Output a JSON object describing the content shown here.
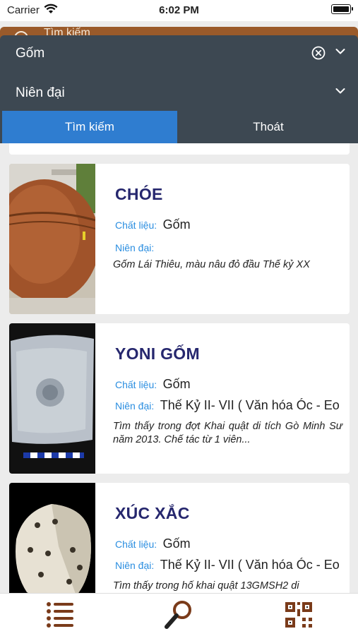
{
  "status_bar": {
    "carrier": "Carrier",
    "time": "6:02 PM"
  },
  "app_header": {
    "search_label": "Tìm kiếm"
  },
  "filter": {
    "material_value": "Gốm",
    "period_placeholder": "Niên đại",
    "search_button": "Tìm kiếm",
    "exit_button": "Thoát"
  },
  "items": [
    {
      "title": "CHÓE",
      "material_label": "Chất liệu:",
      "material": "Gốm",
      "period_label": "Niên đại:",
      "period": "",
      "description": "Gốm Lái Thiêu, màu nâu đỏ đầu Thế kỷ XX"
    },
    {
      "title": "YONI GỐM",
      "material_label": "Chất liệu:",
      "material": "Gốm",
      "period_label": "Niên đại:",
      "period": "Thế Kỷ II- VII ( Văn hóa Óc - Eo",
      "description": "Tìm thấy trong đợt Khai quật di tích Gò Minh Sư năm 2013. Chế tác từ 1 viên..."
    },
    {
      "title": "XÚC XẮC",
      "material_label": "Chất liệu:",
      "material": "Gốm",
      "period_label": "Niên đại:",
      "period": "Thế Kỷ II- VII ( Văn hóa Óc - Eo",
      "description": "Tìm thấy trong hố khai quật 13GMSH2 di"
    }
  ],
  "colors": {
    "header_brown": "#9a5a2a",
    "filter_panel": "#3d4852",
    "search_button": "#2f7dd0",
    "title": "#26276e",
    "field_label": "#2b8ee0",
    "tab_icon": "#7a3b1a"
  },
  "icons": {
    "clear": "clear-circle-icon",
    "chevron": "chevron-down-icon",
    "tabs": [
      "list-icon",
      "search-icon",
      "qr-code-icon"
    ]
  }
}
